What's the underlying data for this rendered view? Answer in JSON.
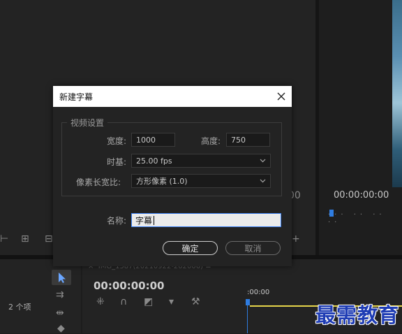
{
  "dialog": {
    "title": "新建字幕",
    "group_label": "视频设置",
    "width_label": "宽度:",
    "width_value": "1000",
    "height_label": "高度:",
    "height_value": "750",
    "timebase_label": "时基:",
    "timebase_value": "25.00 fps",
    "pixel_aspect_label": "像素长宽比:",
    "pixel_aspect_value": "方形像素 (1.0)",
    "name_label": "名称:",
    "name_value": "字幕",
    "ok_label": "确定",
    "cancel_label": "取消"
  },
  "background": {
    "program_timecode": "00:00:00:00",
    "timeline_timecode": "00:00:00:00",
    "sequence_tab": "IMG_1587(20210922-202006)",
    "ruler_start": ":00:00",
    "items_count": "2 个项",
    "right_ghost_number": "00"
  },
  "watermark": "最需教育",
  "icons": [
    "close-icon",
    "chevron-down-icon",
    "selection-tool-icon",
    "track-select-icon",
    "ripple-edit-icon",
    "magnet-icon",
    "marker-icon",
    "wrench-icon",
    "add-icon"
  ],
  "colors": {
    "accent_blue": "#2f7de1",
    "playbar_yellow": "#e5d44a",
    "dialog_bg": "#232323"
  }
}
